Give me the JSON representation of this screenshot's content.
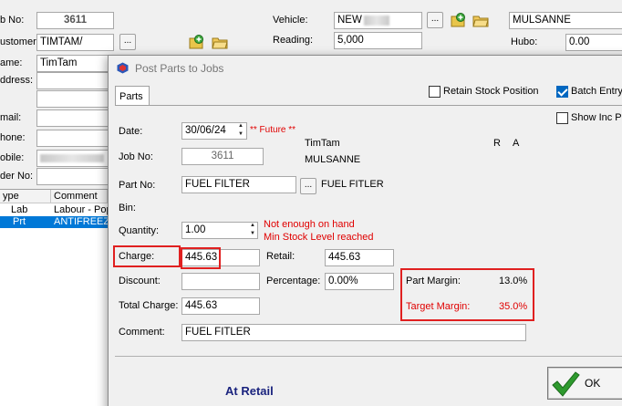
{
  "main": {
    "job_no_label": "b No:",
    "job_no_value": "3611",
    "customer_label": "ustomer:",
    "customer_value": "TIMTAM/",
    "name_label": "ame:",
    "name_value": "TimTam",
    "address_label": "ddress:",
    "email_label": "mail:",
    "phone_label": "hone:",
    "mobile_label": "obile:",
    "order_label": "der No:",
    "vehicle_label": "Vehicle:",
    "vehicle_value": "NEW",
    "vehicle_model": "MULSANNE",
    "reading_label": "Reading:",
    "reading_value": "5,000",
    "hubo_label": "Hubo:",
    "hubo_value": "0.00",
    "dots": "...",
    "grid": {
      "headers": [
        "ype",
        "Comment"
      ],
      "rows": [
        [
          "Lab",
          "Labour - Pop"
        ],
        [
          "Prt",
          "ANTIFREEZE"
        ]
      ]
    }
  },
  "dialog": {
    "title": "Post Parts to Jobs",
    "tab": "Parts",
    "retain_stock_position": "Retain Stock Position",
    "retain_checked": false,
    "batch_entry": "Batch Entry",
    "batch_checked": true,
    "show_inc_price": "Show Inc Pr",
    "show_inc_checked": false,
    "date_label": "Date:",
    "date_value": "30/06/24",
    "future_note": "** Future **",
    "job_no_label": "Job No:",
    "job_no_value": "3611",
    "customer_name": "TimTam",
    "vehicle_model": "MULSANNE",
    "r_label": "R",
    "a_label": "A",
    "part_no_label": "Part No:",
    "part_no_value": "FUEL FILTER",
    "part_desc": "FUEL FITLER",
    "bin_label": "Bin:",
    "quantity_label": "Quantity:",
    "quantity_value": "1.00",
    "warning_1": "Not enough on hand",
    "warning_2": "Min Stock Level reached",
    "charge_label": "Charge:",
    "charge_value": "445.63",
    "retail_label": "Retail:",
    "retail_value": "445.63",
    "discount_label": "Discount:",
    "discount_value": "",
    "percentage_label": "Percentage:",
    "percentage_value": "0.00%",
    "total_charge_label": "Total Charge:",
    "total_charge_value": "445.63",
    "part_margin_label": "Part Margin:",
    "part_margin_value": "13.0%",
    "target_margin_label": "Target Margin:",
    "target_margin_value": "35.0%",
    "comment_label": "Comment:",
    "comment_value": "FUEL FITLER",
    "at_retail": "At Retail",
    "ok_label": "OK",
    "dots": "..."
  },
  "colors": {
    "selection": "#0078d7",
    "warning_red": "#e00000",
    "highlight_box": "#e02020",
    "at_retail": "#1a237e",
    "ok_check": "#2e9a2e"
  }
}
